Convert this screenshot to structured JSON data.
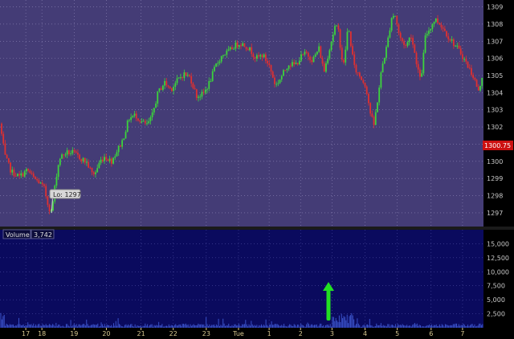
{
  "colors": {
    "price_bg": "#443c76",
    "volume_bg": "#0a0a5e",
    "up": "#3cd43c",
    "down": "#e03030",
    "grid": "#8e86b8",
    "volume_bar": "#3a52c8",
    "last_price_bg": "#cc1010",
    "arrow": "#22e022"
  },
  "chart_data": [
    {
      "type": "candlestick",
      "ylim": [
        1296.2,
        1309.4
      ],
      "y_ticks": [
        "1297",
        "1298",
        "1299",
        "1300",
        "1301",
        "1302",
        "1303",
        "1304",
        "1305",
        "1306",
        "1307",
        "1308",
        "1309"
      ],
      "last_price_label": "1300.75",
      "low_annotation": "Lo: 1297",
      "grid": true,
      "anchors": [
        [
          0,
          1302.2
        ],
        [
          6,
          1300.3
        ],
        [
          14,
          1299.4
        ],
        [
          24,
          1299.1
        ],
        [
          34,
          1299.5
        ],
        [
          42,
          1299.0
        ],
        [
          48,
          1298.8
        ],
        [
          55,
          1298.4
        ],
        [
          60,
          1297.4
        ],
        [
          64,
          1297.0
        ],
        [
          70,
          1299.2
        ],
        [
          74,
          1300.2
        ],
        [
          82,
          1300.5
        ],
        [
          90,
          1300.5
        ],
        [
          100,
          1300.2
        ],
        [
          108,
          1299.9
        ],
        [
          114,
          1299.3
        ],
        [
          118,
          1299.3
        ],
        [
          124,
          1300.0
        ],
        [
          130,
          1300.3
        ],
        [
          138,
          1300.0
        ],
        [
          145,
          1300.6
        ],
        [
          152,
          1301.2
        ],
        [
          160,
          1302.5
        ],
        [
          168,
          1302.7
        ],
        [
          176,
          1302.3
        ],
        [
          182,
          1302.1
        ],
        [
          188,
          1302.5
        ],
        [
          196,
          1304.0
        ],
        [
          204,
          1304.6
        ],
        [
          212,
          1304.2
        ],
        [
          220,
          1304.7
        ],
        [
          228,
          1305.1
        ],
        [
          236,
          1304.9
        ],
        [
          244,
          1303.8
        ],
        [
          252,
          1303.9
        ],
        [
          260,
          1304.6
        ],
        [
          268,
          1305.6
        ],
        [
          276,
          1306.2
        ],
        [
          284,
          1306.4
        ],
        [
          290,
          1306.7
        ],
        [
          298,
          1306.9
        ],
        [
          306,
          1306.7
        ],
        [
          312,
          1306.4
        ],
        [
          318,
          1306.0
        ],
        [
          326,
          1306.2
        ],
        [
          334,
          1305.6
        ],
        [
          342,
          1304.4
        ],
        [
          350,
          1305.0
        ],
        [
          358,
          1305.7
        ],
        [
          366,
          1305.6
        ],
        [
          374,
          1306.1
        ],
        [
          380,
          1306.3
        ],
        [
          388,
          1305.9
        ],
        [
          396,
          1306.6
        ],
        [
          402,
          1305.2
        ],
        [
          410,
          1306.8
        ],
        [
          416,
          1307.9
        ],
        [
          420,
          1307.6
        ],
        [
          426,
          1305.4
        ],
        [
          432,
          1307.9
        ],
        [
          440,
          1305.4
        ],
        [
          446,
          1305.0
        ],
        [
          454,
          1304.4
        ],
        [
          460,
          1302.7
        ],
        [
          464,
          1302.1
        ],
        [
          468,
          1303.4
        ],
        [
          474,
          1305.5
        ],
        [
          480,
          1306.7
        ],
        [
          486,
          1308.4
        ],
        [
          490,
          1308.6
        ],
        [
          496,
          1307.2
        ],
        [
          504,
          1306.7
        ],
        [
          510,
          1307.4
        ],
        [
          516,
          1306.0
        ],
        [
          522,
          1304.6
        ],
        [
          528,
          1307.3
        ],
        [
          534,
          1307.8
        ],
        [
          540,
          1308.3
        ],
        [
          548,
          1307.9
        ],
        [
          556,
          1307.3
        ],
        [
          564,
          1306.8
        ],
        [
          572,
          1306.3
        ],
        [
          580,
          1305.6
        ],
        [
          588,
          1304.9
        ],
        [
          594,
          1304.0
        ],
        [
          600,
          1305.4
        ]
      ]
    },
    {
      "type": "bar",
      "label": "Volume",
      "value_label": "3,742",
      "ylim": [
        0,
        17500
      ],
      "y_ticks": [
        2500,
        5000,
        7500,
        10000,
        12500,
        15000
      ],
      "y_tick_labels": [
        "2,500",
        "5,000",
        "7,500",
        "10,000",
        "12,500",
        "15,000"
      ],
      "x_ticks": [
        "17",
        "18",
        "19",
        "20",
        "21",
        "22",
        "23",
        "Tue",
        "1",
        "2",
        "3",
        "4",
        "5",
        "6",
        "7"
      ],
      "x_tick_values": [
        32,
        52,
        92,
        132,
        175,
        215,
        256,
        296,
        334,
        373,
        412,
        453,
        493,
        535,
        574
      ],
      "xlim": [
        0,
        600
      ],
      "annotation": "arrow"
    }
  ]
}
